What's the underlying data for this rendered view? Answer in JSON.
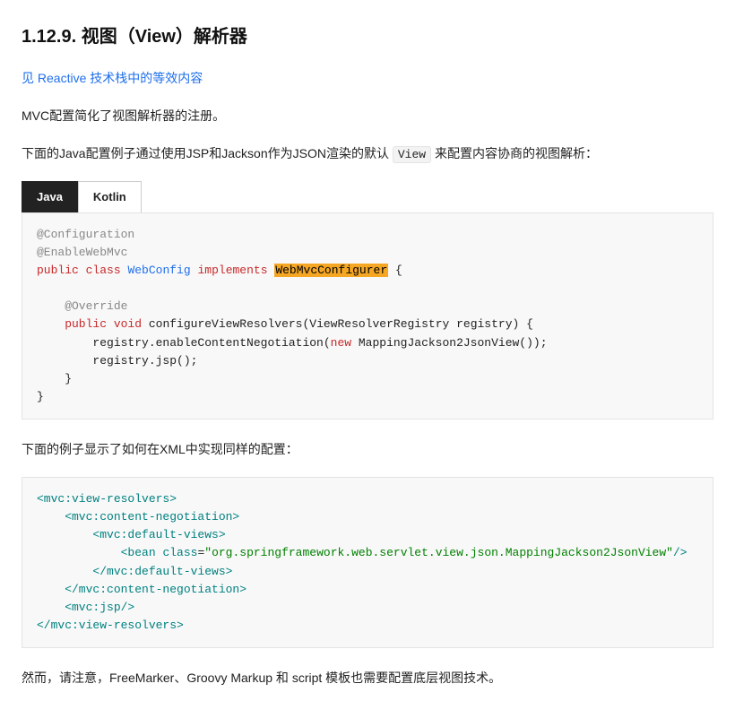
{
  "heading": "1.12.9. 视图（View）解析器",
  "reactive_link": "见 Reactive 技术栈中的等效内容",
  "intro": "MVC配置简化了视图解析器的注册。",
  "para1_before": "下面的Java配置例子通过使用JSP和Jackson作为JSON渲染的默认 ",
  "para1_code": "View",
  "para1_after": " 来配置内容协商的视图解析：",
  "tabs": {
    "java": "Java",
    "kotlin": "Kotlin"
  },
  "code_java": {
    "l1": "@Configuration",
    "l2": "@EnableWebMvc",
    "l3_kw1": "public",
    "l3_kw2": "class",
    "l3_type": "WebConfig",
    "l3_kw3": "implements",
    "l3_hl": "WebMvcConfigurer",
    "l3_end": " {",
    "l4": "    @Override",
    "l5_kw1": "    public",
    "l5_kw2": "void",
    "l5_rest": " configureViewResolvers(ViewResolverRegistry registry) {",
    "l6_a": "        registry.enableContentNegotiation(",
    "l6_kw": "new",
    "l6_b": " MappingJackson2JsonView());",
    "l7": "        registry.jsp();",
    "l8": "    }",
    "l9": "}"
  },
  "xml_intro": "下面的例子显示了如何在XML中实现同样的配置：",
  "code_xml": {
    "l1": "<mvc:view-resolvers>",
    "l2": "    <mvc:content-negotiation>",
    "l3": "        <mvc:default-views>",
    "l4_a": "            <bean ",
    "l4_attr": "class",
    "l4_eq": "=",
    "l4_str": "\"org.springframework.web.servlet.view.json.MappingJackson2JsonView\"",
    "l4_b": "/>",
    "l5": "        </mvc:default-views>",
    "l6": "    </mvc:content-negotiation>",
    "l7": "    <mvc:jsp/>",
    "l8": "</mvc:view-resolvers>"
  },
  "note": "然而，请注意，FreeMarker、Groovy Markup 和 script 模板也需要配置底层视图技术。"
}
